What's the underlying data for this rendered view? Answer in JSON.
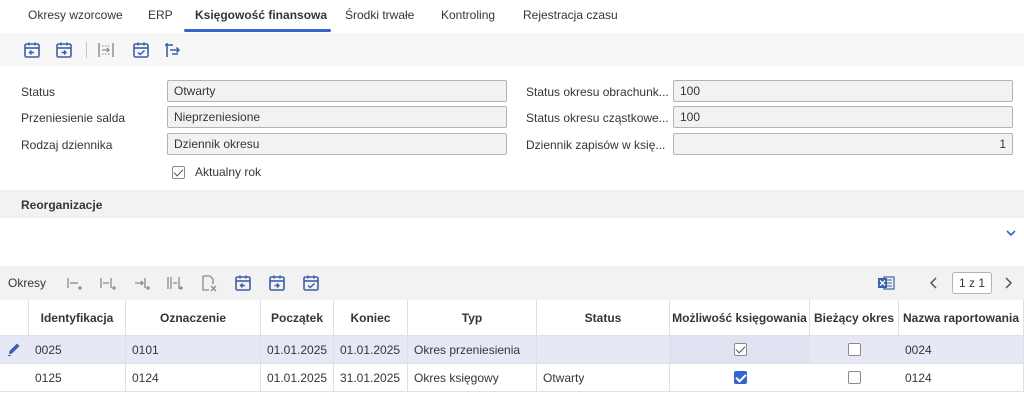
{
  "tabs": [
    "Okresy wzorcowe",
    "ERP",
    "Księgowość finansowa",
    "Środki trwałe",
    "Kontroling",
    "Rejestracja czasu"
  ],
  "toolbar_icons": [
    "calendar-prev-icon",
    "calendar-next-icon",
    "insert-column-icon",
    "calendar-check-icon",
    "transfer-icon"
  ],
  "form": {
    "status_label": "Status",
    "status_value": "Otwarty",
    "balance_label": "Przeniesienie salda",
    "balance_value": "Nieprzeniesione",
    "journal_label": "Rodzaj dziennika",
    "journal_value": "Dziennik okresu",
    "current_year_label": "Aktualny rok",
    "period_status_label": "Status okresu obrachunk...",
    "period_status_value": "100",
    "partial_status_label": "Status okresu cząstkowe...",
    "partial_status_value": "100",
    "posting_journal_label": "Dziennik zapisów w księ...",
    "posting_journal_value": "1"
  },
  "reorg": {
    "title": "Reorganizacje"
  },
  "periods": {
    "title": "Okresy",
    "pager": "1 z 1",
    "columns": [
      "Identyfikacja",
      "Oznaczenie",
      "Początek",
      "Koniec",
      "Typ",
      "Status",
      "Możliwość księgowania",
      "Bieżący okres",
      "Nazwa raportowania"
    ],
    "rows": [
      {
        "id": "0025",
        "name": "0101",
        "start": "01.01.2025",
        "end": "01.01.2025",
        "type": "Okres przeniesienia",
        "status": "",
        "posting": true,
        "current": false,
        "report": "0024"
      },
      {
        "id": "0125",
        "name": "0124",
        "start": "01.01.2025",
        "end": "31.01.2025",
        "type": "Okres księgowy",
        "status": "Otwarty",
        "posting": true,
        "current": false,
        "report": "0124"
      }
    ]
  }
}
